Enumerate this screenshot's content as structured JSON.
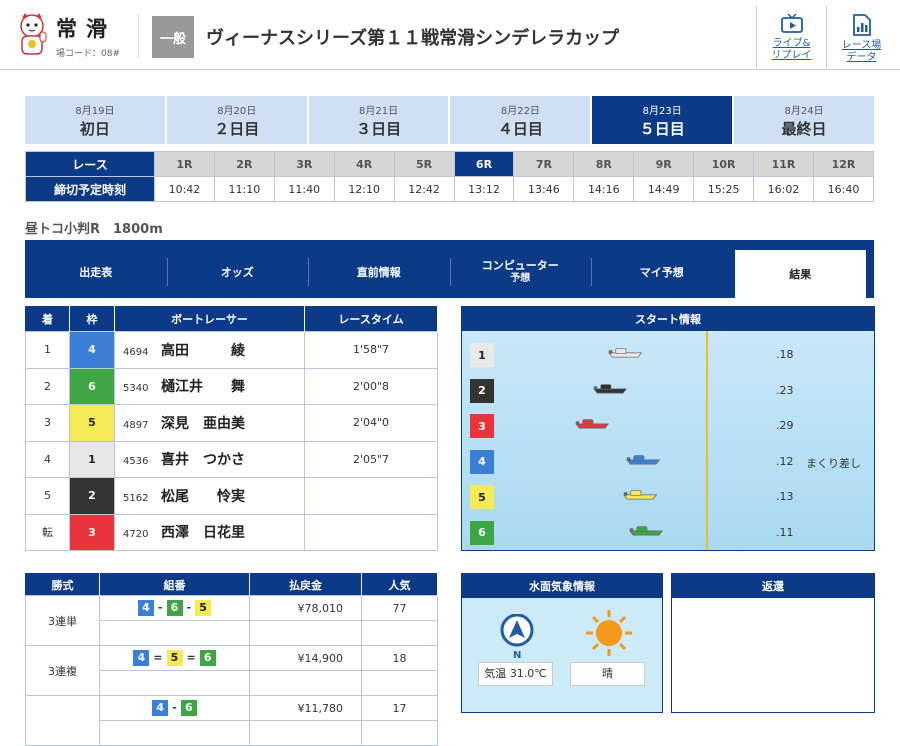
{
  "header": {
    "venue": "常滑",
    "venue_code": "場コード：08#",
    "grade": "一般",
    "race_title": "ヴィーナスシリーズ第１１戦常滑シンデレラカップ",
    "buttons": [
      {
        "label1": "ライブ&",
        "label2": "リプレイ",
        "icon": "tv-icon"
      },
      {
        "label1": "レース場",
        "label2": "データ",
        "icon": "chart-icon"
      }
    ]
  },
  "days": [
    {
      "date": "8月19日",
      "label": "初日",
      "active": false
    },
    {
      "date": "8月20日",
      "label": "２日目",
      "active": false
    },
    {
      "date": "8月21日",
      "label": "３日目",
      "active": false
    },
    {
      "date": "8月22日",
      "label": "４日目",
      "active": false
    },
    {
      "date": "8月23日",
      "label": "５日目",
      "active": true
    },
    {
      "date": "8月24日",
      "label": "最終日",
      "active": false
    }
  ],
  "race_table": {
    "row1_header": "レース",
    "row2_header": "締切予定時刻",
    "races": [
      "1R",
      "2R",
      "3R",
      "4R",
      "5R",
      "6R",
      "7R",
      "8R",
      "9R",
      "10R",
      "11R",
      "12R"
    ],
    "times": [
      "10:42",
      "11:10",
      "11:40",
      "12:10",
      "12:42",
      "13:12",
      "13:46",
      "14:16",
      "14:49",
      "15:25",
      "16:02",
      "16:40"
    ],
    "active_index": 5
  },
  "race_condition": "昼トコ小判R　1800m",
  "tabs": [
    {
      "label": "出走表",
      "sub": ""
    },
    {
      "label": "オッズ",
      "sub": ""
    },
    {
      "label": "直前情報",
      "sub": ""
    },
    {
      "label": "コンピューター",
      "sub": "予想"
    },
    {
      "label": "マイ予想",
      "sub": ""
    },
    {
      "label": "結果",
      "sub": "",
      "active": true
    }
  ],
  "results": {
    "headers": [
      "着",
      "枠",
      "ボートレーサー",
      "レースタイム"
    ],
    "rows": [
      {
        "rank": "1",
        "frame": "4",
        "reg": "4694",
        "name": "高田　　　綾",
        "time": "1'58\"7"
      },
      {
        "rank": "2",
        "frame": "6",
        "reg": "5340",
        "name": "樋江井　　舞",
        "time": "2'00\"8"
      },
      {
        "rank": "3",
        "frame": "5",
        "reg": "4897",
        "name": "深見　亜由美",
        "time": "2'04\"0"
      },
      {
        "rank": "4",
        "frame": "1",
        "reg": "4536",
        "name": "喜井　つかさ",
        "time": "2'05\"7"
      },
      {
        "rank": "5",
        "frame": "2",
        "reg": "5162",
        "name": "松尾　　怜実",
        "time": ""
      },
      {
        "rank": "転",
        "frame": "3",
        "reg": "4720",
        "name": "西澤　日花里",
        "time": ""
      }
    ]
  },
  "start_info": {
    "title": "スタート情報",
    "rows": [
      {
        "frame": "1",
        "st": ".18",
        "tech": ""
      },
      {
        "frame": "2",
        "st": ".23",
        "tech": ""
      },
      {
        "frame": "3",
        "st": ".29",
        "tech": ""
      },
      {
        "frame": "4",
        "st": ".12",
        "tech": "まくり差し"
      },
      {
        "frame": "5",
        "st": ".13",
        "tech": ""
      },
      {
        "frame": "6",
        "st": ".11",
        "tech": ""
      }
    ]
  },
  "payouts": {
    "headers": [
      "勝式",
      "組番",
      "払戻金",
      "人気"
    ],
    "rows": [
      {
        "type": "3連単",
        "combo": [
          "4",
          "6",
          "5"
        ],
        "sep": "-",
        "amount": "¥78,010",
        "pop": "77"
      },
      {
        "type": "3連複",
        "combo": [
          "4",
          "5",
          "6"
        ],
        "sep": "=",
        "amount": "¥14,900",
        "pop": "18"
      },
      {
        "type": "",
        "combo": [
          "4",
          "6"
        ],
        "sep": "-",
        "amount": "¥11,780",
        "pop": "17"
      }
    ]
  },
  "weather": {
    "title": "水面気象情報",
    "temp_label": "気温",
    "temp": "31.0℃",
    "weather": "晴",
    "wind_dir": "N"
  },
  "refund": {
    "title": "返還"
  },
  "frame_colors": {
    "1": "#e8e8e8",
    "2": "#333333",
    "3": "#e8343a",
    "4": "#3b7fd6",
    "5": "#f3ea55",
    "6": "#3fa645"
  },
  "frame_text": {
    "1": "#222",
    "2": "#fff",
    "3": "#fff",
    "4": "#fff",
    "5": "#222",
    "6": "#fff"
  }
}
